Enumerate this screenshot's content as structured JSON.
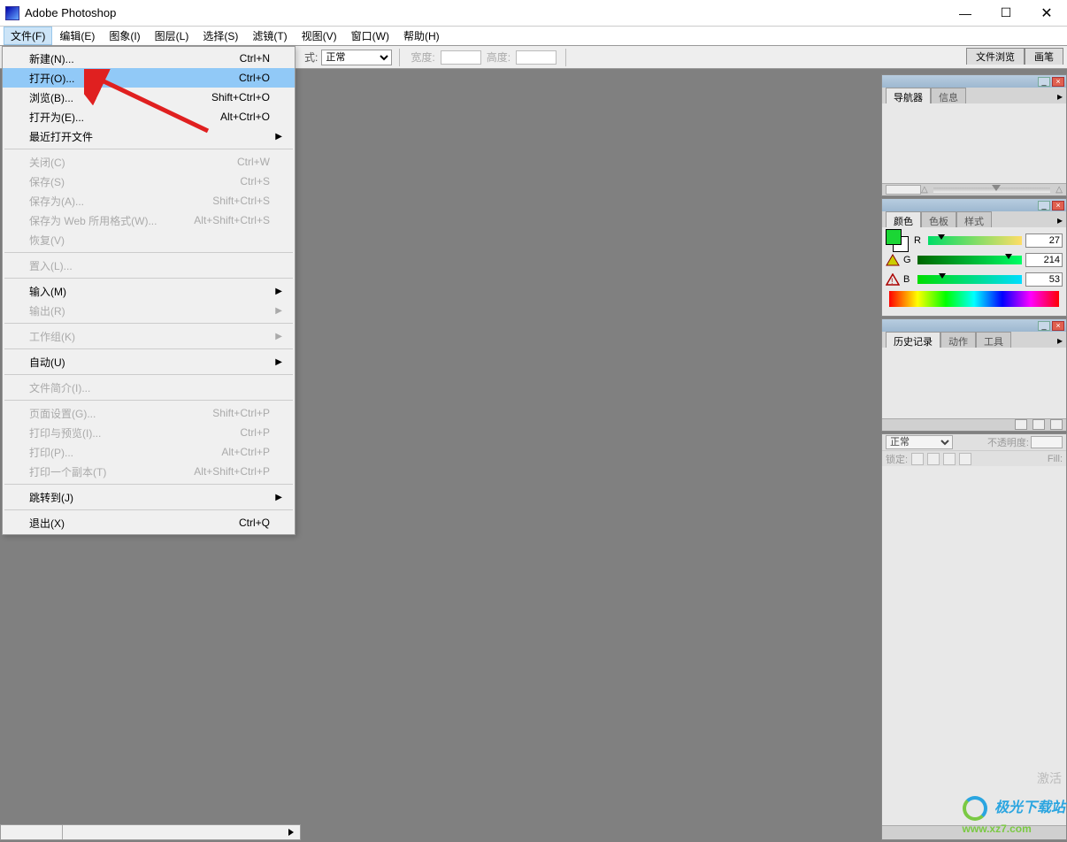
{
  "titlebar": {
    "title": "Adobe Photoshop"
  },
  "menubar": {
    "items": [
      "文件(F)",
      "编辑(E)",
      "图象(I)",
      "图层(L)",
      "选择(S)",
      "滤镜(T)",
      "视图(V)",
      "窗口(W)",
      "帮助(H)"
    ]
  },
  "optionsbar": {
    "mode_label": "式:",
    "mode_value": "正常",
    "width_label": "宽度:",
    "height_label": "高度:"
  },
  "rightTabs": {
    "t1": "文件浏览",
    "t2": "画笔"
  },
  "filemenu": {
    "new": {
      "label": "新建(N)...",
      "sc": "Ctrl+N"
    },
    "open": {
      "label": "打开(O)...",
      "sc": "Ctrl+O"
    },
    "browse": {
      "label": "浏览(B)...",
      "sc": "Shift+Ctrl+O"
    },
    "openas": {
      "label": "打开为(E)...",
      "sc": "Alt+Ctrl+O"
    },
    "recent": {
      "label": "最近打开文件"
    },
    "close": {
      "label": "关闭(C)",
      "sc": "Ctrl+W"
    },
    "save": {
      "label": "保存(S)",
      "sc": "Ctrl+S"
    },
    "saveas": {
      "label": "保存为(A)...",
      "sc": "Shift+Ctrl+S"
    },
    "saveweb": {
      "label": "保存为 Web 所用格式(W)...",
      "sc": "Alt+Shift+Ctrl+S"
    },
    "revert": {
      "label": "恢复(V)"
    },
    "place": {
      "label": "置入(L)..."
    },
    "import": {
      "label": "输入(M)"
    },
    "export": {
      "label": "输出(R)"
    },
    "workgroup": {
      "label": "工作组(K)"
    },
    "automate": {
      "label": "自动(U)"
    },
    "fileinfo": {
      "label": "文件简介(I)..."
    },
    "pagesetup": {
      "label": "页面设置(G)...",
      "sc": "Shift+Ctrl+P"
    },
    "printpreview": {
      "label": "打印与预览(I)...",
      "sc": "Ctrl+P"
    },
    "print": {
      "label": "打印(P)...",
      "sc": "Alt+Ctrl+P"
    },
    "printone": {
      "label": "打印一个副本(T)",
      "sc": "Alt+Shift+Ctrl+P"
    },
    "jumpto": {
      "label": "跳转到(J)"
    },
    "exit": {
      "label": "退出(X)",
      "sc": "Ctrl+Q"
    }
  },
  "panels": {
    "nav": {
      "tabs": [
        "导航器",
        "信息"
      ]
    },
    "color": {
      "tabs": [
        "颜色",
        "色板",
        "样式"
      ],
      "r": {
        "label": "R",
        "value": "27"
      },
      "g": {
        "label": "G",
        "value": "214"
      },
      "b": {
        "label": "B",
        "value": "53"
      }
    },
    "history": {
      "tabs": [
        "历史记录",
        "动作",
        "工具"
      ]
    },
    "layers": {
      "blend": "正常",
      "opacity_label": "不透明度:",
      "lock_label": "锁定:",
      "fill_label": "Fill:"
    }
  },
  "watermark": {
    "line1": "极光下载站",
    "line2": "www.xz7.com"
  },
  "activate": "激活"
}
